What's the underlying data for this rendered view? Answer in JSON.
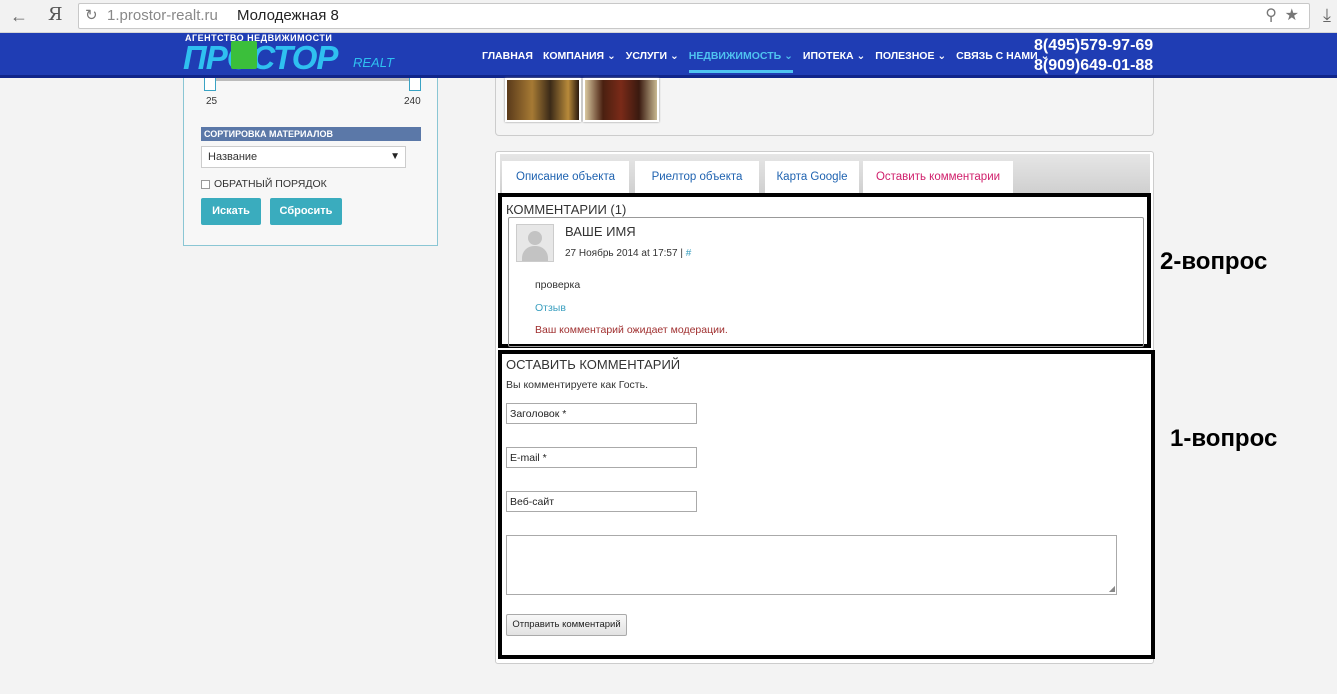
{
  "browser": {
    "url": "1.prostor-realt.ru",
    "page_title": "Молодежная 8"
  },
  "header": {
    "logo_tagline": "АГЕНТСТВО НЕДВИЖИМОСТИ",
    "logo_word": "ПРОСТОР",
    "logo_realt": "REALT",
    "menu": [
      {
        "label": "ГЛАВНАЯ"
      },
      {
        "label": "КОМПАНИЯ ⌄"
      },
      {
        "label": "УСЛУГИ ⌄"
      },
      {
        "label": "НЕДВИЖИМОСТЬ ⌄",
        "active": true
      },
      {
        "label": "ИПОТЕКА ⌄"
      },
      {
        "label": "ПОЛЕЗНОЕ ⌄"
      },
      {
        "label": "СВЯЗЬ С НАМИ ⌄"
      }
    ],
    "phone1": "8(495)579-97-69",
    "phone2": "8(909)649-01-88"
  },
  "sidebar": {
    "slider_min": "25",
    "slider_max": "240",
    "sort_heading": "СОРТИРОВКА МАТЕРИАЛОВ",
    "sort_value": "Название",
    "reverse_label": "ОБРАТНЫЙ ПОРЯДОК",
    "search_button": "Искать",
    "reset_button": "Сбросить"
  },
  "tabs": [
    {
      "label": "Описание объекта"
    },
    {
      "label": "Риелтор объекта"
    },
    {
      "label": "Карта Google"
    },
    {
      "label": "Оставить комментарии",
      "active": true
    }
  ],
  "comments": {
    "title": "КОММЕНТАРИИ (1)",
    "items": [
      {
        "name": "ВАШЕ ИМЯ",
        "date": "27 Ноябрь 2014 at 17:57 |",
        "hash": "#",
        "text": "проверка",
        "reply": "Отзыв",
        "moderation": "Ваш комментарий ожидает модерации."
      }
    ]
  },
  "comment_form": {
    "title": "ОСТАВИТЬ КОММЕНТАРИЙ",
    "guest_note": "Вы комментируете как Гость.",
    "title_field": "Заголовок *",
    "email_field": "E-mail *",
    "website_field": "Веб-сайт",
    "submit": "Отправить комментарий"
  },
  "annotations": {
    "q2": "2-вопрос",
    "q1": "1-вопрос"
  },
  "colors": {
    "header_bg": "#1f3db4",
    "accent_teal": "#3aacbe",
    "active_tab": "#d0206c",
    "link": "#1e62b0"
  }
}
